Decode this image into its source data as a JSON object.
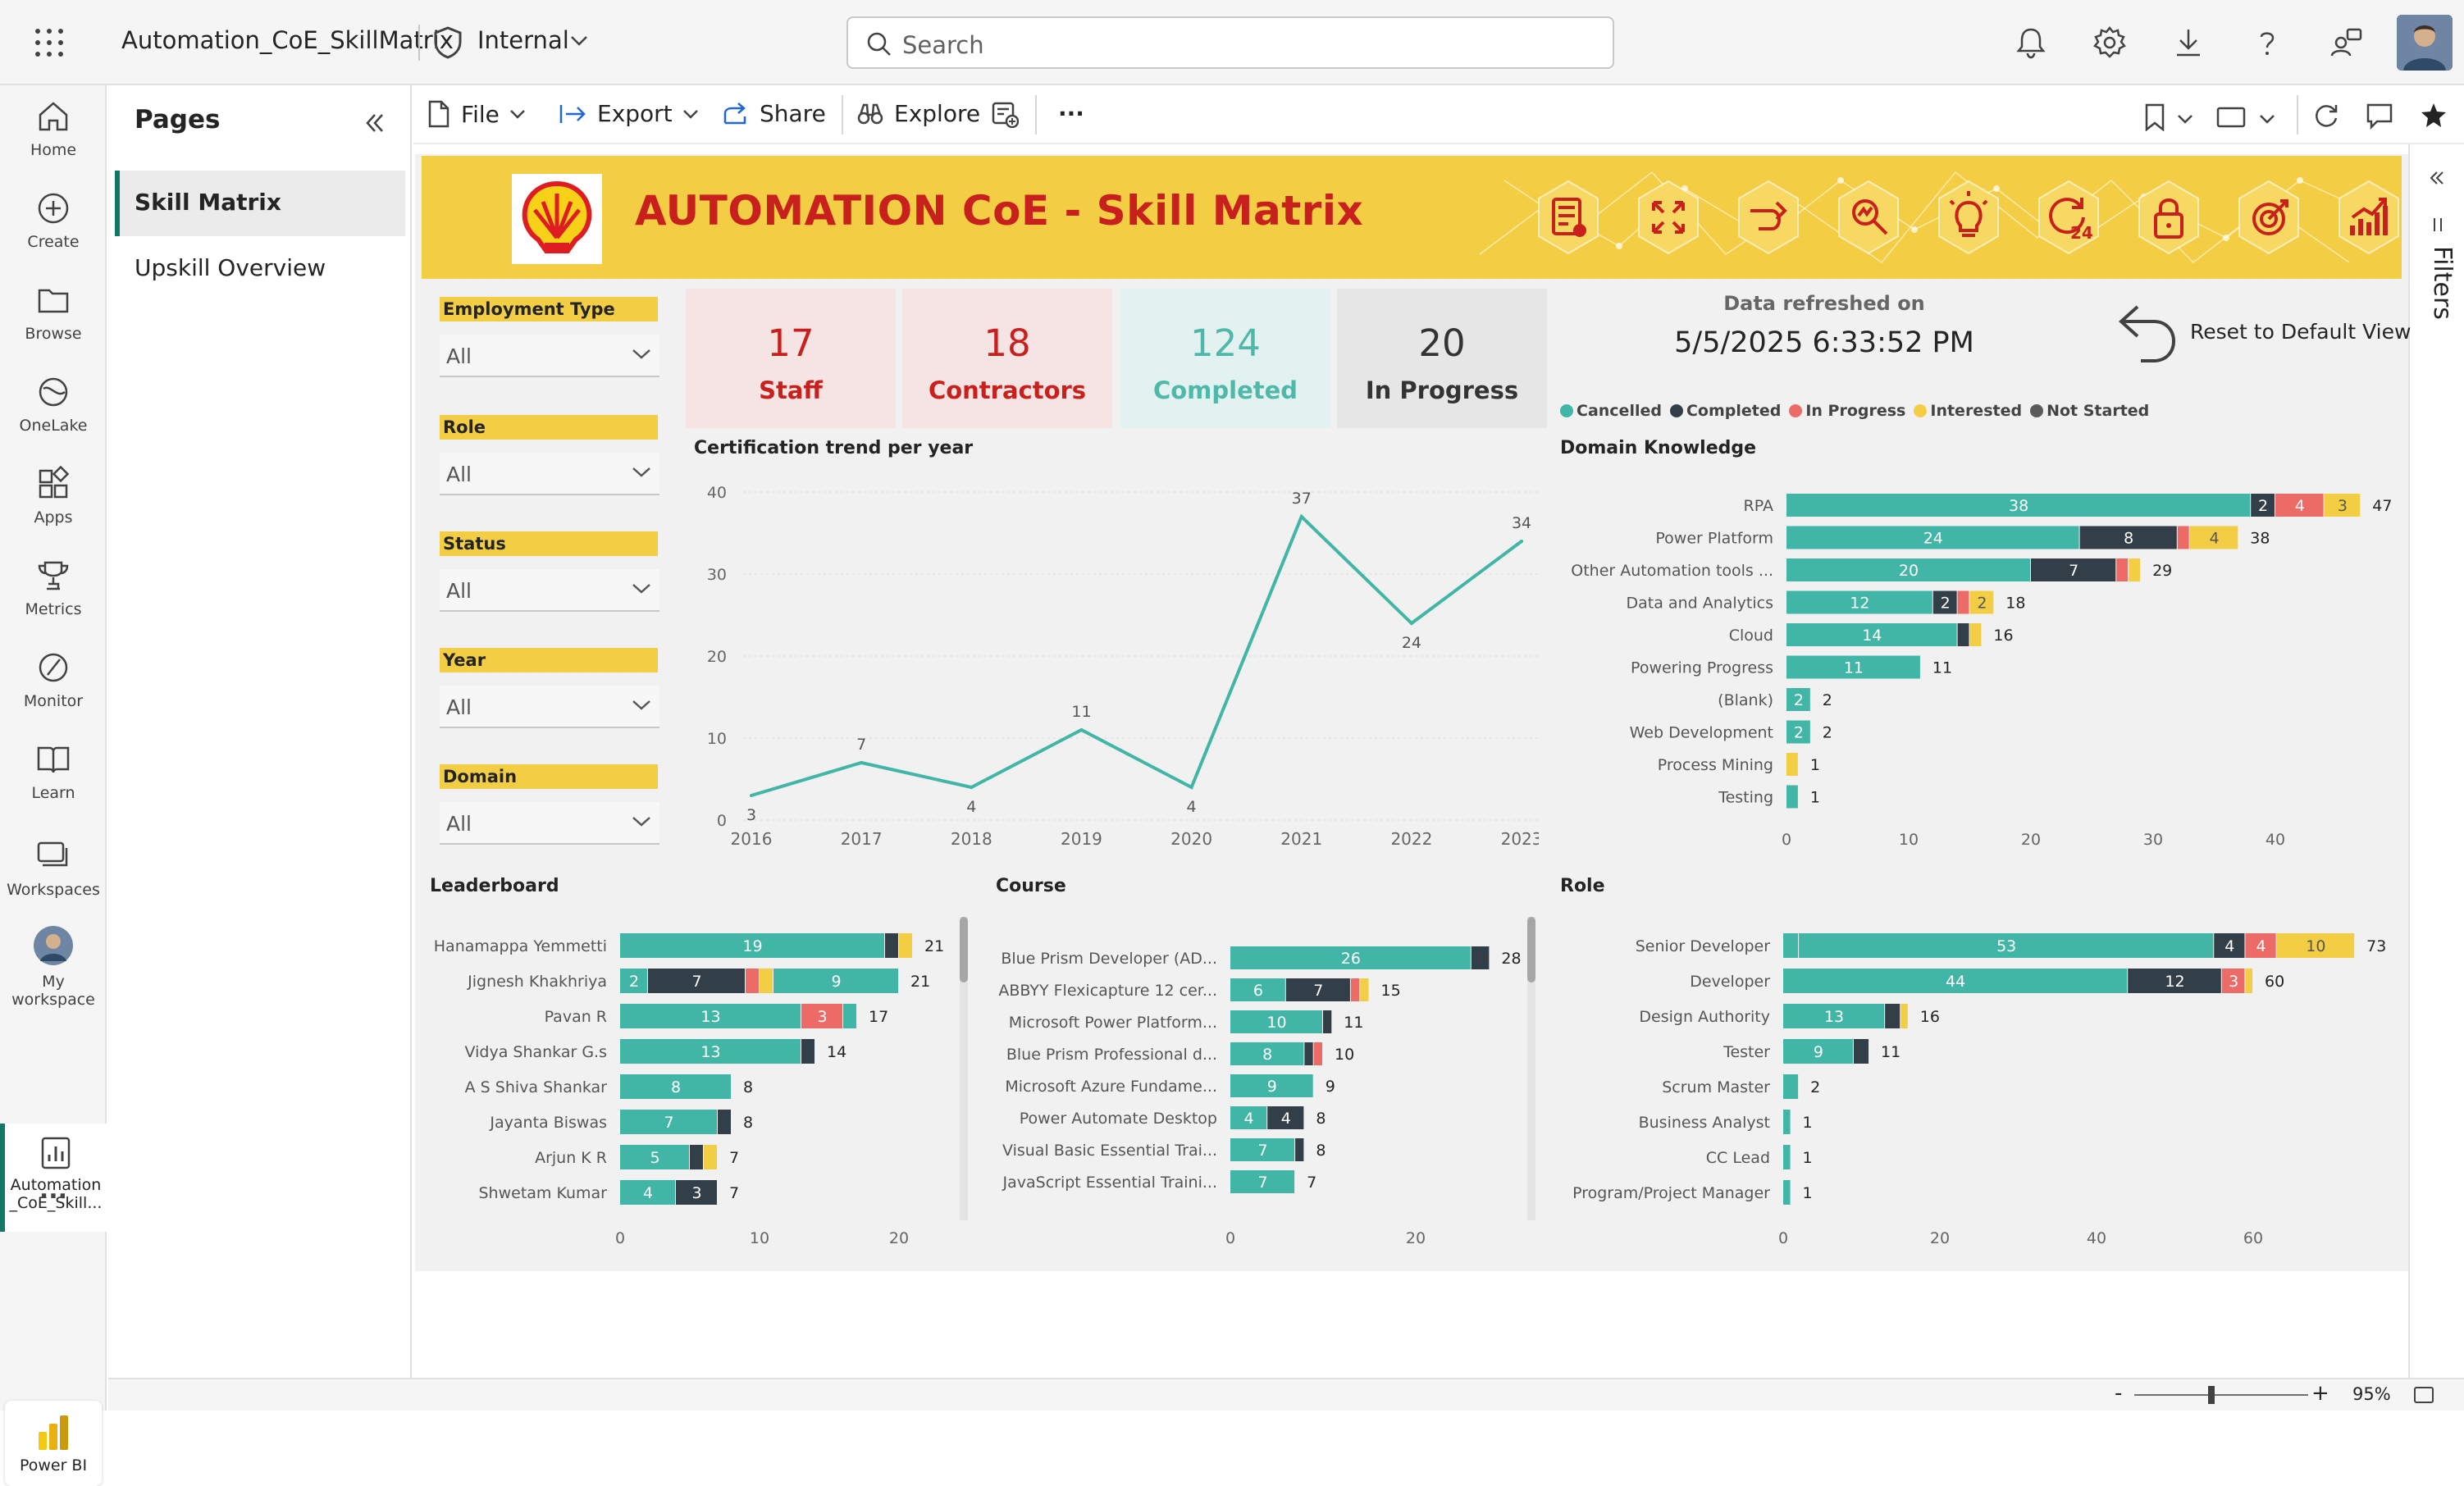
{
  "topbar": {
    "app_title": "Automation_CoE_SkillMatrix",
    "sensitivity": "Internal",
    "search_placeholder": "Search"
  },
  "leftnav": [
    {
      "label": "Home",
      "icon": "home-icon"
    },
    {
      "label": "Create",
      "icon": "plus-circle-icon"
    },
    {
      "label": "Browse",
      "icon": "folder-icon"
    },
    {
      "label": "OneLake",
      "icon": "onelake-icon"
    },
    {
      "label": "Apps",
      "icon": "apps-icon"
    },
    {
      "label": "Metrics",
      "icon": "trophy-icon"
    },
    {
      "label": "Monitor",
      "icon": "monitor-icon"
    },
    {
      "label": "Learn",
      "icon": "book-icon"
    },
    {
      "label": "Workspaces",
      "icon": "workspaces-icon"
    }
  ],
  "leftnav_extra": {
    "my_workspace_1": "My",
    "my_workspace_2": "workspace",
    "report_1": "Automation",
    "report_2": "_CoE_Skill...",
    "more": "...",
    "powerbi": "Power BI"
  },
  "pages": {
    "title": "Pages",
    "items": [
      "Skill Matrix",
      "Upskill Overview"
    ]
  },
  "toolbar": {
    "file": "File",
    "export": "Export",
    "share": "Share",
    "explore": "Explore",
    "more": "···"
  },
  "right_rail": {
    "filters": "Filters"
  },
  "status": {
    "zoom": "95%"
  },
  "report": {
    "banner_title": "AUTOMATION CoE - Skill Matrix",
    "slicers": [
      {
        "label": "Employment Type",
        "value": "All"
      },
      {
        "label": "Role",
        "value": "All"
      },
      {
        "label": "Status",
        "value": "All"
      },
      {
        "label": "Year",
        "value": "All"
      },
      {
        "label": "Domain",
        "value": "All"
      }
    ],
    "kpis": [
      {
        "value": "17",
        "label": "Staff",
        "color": "#c8201c",
        "bg": "#f6e3e3"
      },
      {
        "value": "18",
        "label": "Contractors",
        "color": "#c8201c",
        "bg": "#f6e3e3"
      },
      {
        "value": "124",
        "label": "Completed",
        "color": "#4fb8a8",
        "bg": "#e2f2f0"
      },
      {
        "value": "20",
        "label": "In Progress",
        "color": "#333333",
        "bg": "#e6e6e6"
      }
    ],
    "refresh_label": "Data refreshed on",
    "refresh_value": "5/5/2025 6:33:52 PM",
    "reset_label": "Reset to Default View",
    "legend": [
      {
        "name": "Cancelled",
        "color": "#41b6a6"
      },
      {
        "name": "Completed",
        "color": "#333f48"
      },
      {
        "name": "In Progress",
        "color": "#ec6b67"
      },
      {
        "name": "Interested",
        "color": "#f3ce44"
      },
      {
        "name": "Not Started",
        "color": "#5b5b5b"
      }
    ]
  },
  "chart_data": [
    {
      "id": "trend",
      "type": "line",
      "title": "Certification trend per year",
      "x": [
        "2016",
        "2017",
        "2018",
        "2019",
        "2020",
        "2021",
        "2022",
        "2023"
      ],
      "values": [
        3,
        7,
        4,
        11,
        4,
        37,
        24,
        34
      ],
      "ylim": [
        0,
        40
      ],
      "yticks": [
        0,
        10,
        20,
        30,
        40
      ],
      "color": "#41b6a6"
    },
    {
      "id": "domain",
      "type": "bar",
      "title": "Domain Knowledge",
      "categories": [
        "RPA",
        "Power Platform",
        "Other Automation tools ...",
        "Data and Analytics",
        "Cloud",
        "Powering Progress",
        "(Blank)",
        "Web Development",
        "Process Mining",
        "Testing"
      ],
      "series": [
        {
          "name": "Cancelled",
          "values": [
            38,
            24,
            20,
            12,
            14,
            11,
            2,
            2,
            0,
            1
          ]
        },
        {
          "name": "Completed",
          "values": [
            2,
            8,
            7,
            2,
            1,
            0,
            0,
            0,
            0,
            0
          ]
        },
        {
          "name": "In Progress",
          "values": [
            4,
            1,
            1,
            1,
            0,
            0,
            0,
            0,
            0,
            0
          ]
        },
        {
          "name": "Interested",
          "values": [
            3,
            4,
            1,
            2,
            1,
            0,
            0,
            0,
            1,
            0
          ]
        }
      ],
      "totals": [
        47,
        38,
        29,
        18,
        16,
        11,
        2,
        2,
        1,
        1
      ],
      "xticks": [
        0,
        10,
        20,
        30,
        40
      ]
    },
    {
      "id": "leader",
      "type": "bar",
      "title": "Leaderboard",
      "categories": [
        "Hanamappa Yemmetti",
        "Jignesh Khakhriya",
        "Pavan R",
        "Vidya Shankar G.s",
        "A S Shiva Shankar",
        "Jayanta Biswas",
        "Arjun K R",
        "Shwetam Kumar"
      ],
      "series": [
        {
          "name": "Cancelled",
          "values": [
            19,
            2,
            13,
            13,
            8,
            7,
            5,
            4
          ]
        },
        {
          "name": "Completed",
          "values": [
            1,
            7,
            0,
            1,
            0,
            1,
            1,
            3
          ]
        },
        {
          "name": "In Progress",
          "values": [
            0,
            1,
            3,
            0,
            0,
            0,
            0,
            0
          ]
        },
        {
          "name": "Interested",
          "values": [
            1,
            1,
            0,
            0,
            0,
            0,
            1,
            0
          ]
        },
        {
          "name": "Not Started",
          "values": [
            0,
            9,
            1,
            0,
            0,
            0,
            0,
            0
          ]
        }
      ],
      "totals": [
        21,
        21,
        17,
        14,
        8,
        8,
        7,
        7
      ],
      "xticks": [
        0,
        10,
        20
      ]
    },
    {
      "id": "course",
      "type": "bar",
      "title": "Course",
      "categories": [
        "Blue Prism Developer (AD...",
        "ABBYY Flexicapture 12 cer...",
        "Microsoft Power Platform...",
        "Blue Prism Professional d...",
        "Microsoft Azure Fundame...",
        "Power Automate Desktop",
        "Visual Basic Essential Trai...",
        "JavaScript Essential Traini..."
      ],
      "series": [
        {
          "name": "Cancelled",
          "values": [
            26,
            6,
            10,
            8,
            9,
            4,
            7,
            7
          ]
        },
        {
          "name": "Completed",
          "values": [
            2,
            7,
            1,
            1,
            0,
            4,
            1,
            0
          ]
        },
        {
          "name": "In Progress",
          "values": [
            0,
            1,
            0,
            1,
            0,
            0,
            0,
            0
          ]
        },
        {
          "name": "Interested",
          "values": [
            0,
            1,
            0,
            0,
            0,
            0,
            0,
            0
          ]
        }
      ],
      "totals": [
        28,
        15,
        11,
        10,
        9,
        8,
        8,
        7
      ],
      "xticks": [
        0,
        20
      ]
    },
    {
      "id": "role",
      "type": "bar",
      "title": "Role",
      "categories": [
        "Senior Developer",
        "Developer",
        "Design Authority",
        "Tester",
        "Scrum Master",
        "Business Analyst",
        "CC Lead",
        "Program/Project Manager"
      ],
      "series": [
        {
          "name": "Not Started",
          "values": [
            2,
            0,
            0,
            0,
            0,
            0,
            0,
            0
          ]
        },
        {
          "name": "Cancelled",
          "values": [
            53,
            44,
            13,
            9,
            2,
            1,
            1,
            1
          ]
        },
        {
          "name": "Completed",
          "values": [
            4,
            12,
            2,
            2,
            0,
            0,
            0,
            0
          ]
        },
        {
          "name": "In Progress",
          "values": [
            4,
            3,
            0,
            0,
            0,
            0,
            0,
            0
          ]
        },
        {
          "name": "Interested",
          "values": [
            10,
            1,
            1,
            0,
            0,
            0,
            0,
            0
          ]
        }
      ],
      "totals": [
        73,
        60,
        16,
        11,
        2,
        1,
        1,
        1
      ],
      "xticks": [
        0,
        20,
        40,
        60
      ]
    }
  ]
}
